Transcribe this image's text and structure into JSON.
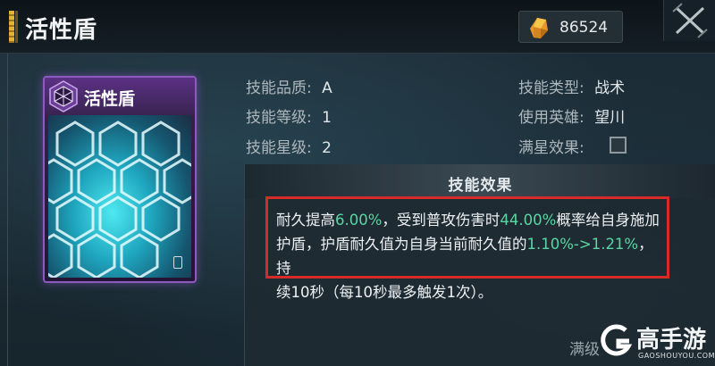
{
  "window": {
    "title": "活性盾",
    "currency_value": "86524"
  },
  "card": {
    "name": "活性盾",
    "accent_color": "#8d5bbf"
  },
  "info": {
    "quality_label": "技能品质:",
    "quality_value": "A",
    "level_label": "技能等级:",
    "level_value": "1",
    "star_label": "技能星级:",
    "star_value": "2",
    "type_label": "技能类型:",
    "type_value": "战术",
    "hero_label": "使用英雄:",
    "hero_value": "望川",
    "fullstar_label": "满星效果:"
  },
  "effect": {
    "title": "技能效果",
    "line1_a": "耐久提高",
    "line1_b": "6.00%",
    "line1_c": "，受到普攻伤害时",
    "line1_d": "44.00%",
    "line1_e": "概率给自身施加",
    "line2_a": "护盾，护盾耐久值为自身当前耐久值的",
    "line2_b": "1.10%->1.21%",
    "line2_c": "，持",
    "line3": "续10秒（每10秒最多触发1次）。",
    "max_level_label": "满级",
    "highlight_color": "#58d7a2"
  },
  "watermark": {
    "text": "高手游",
    "sub": "GAOSHOUYOU.COM"
  }
}
